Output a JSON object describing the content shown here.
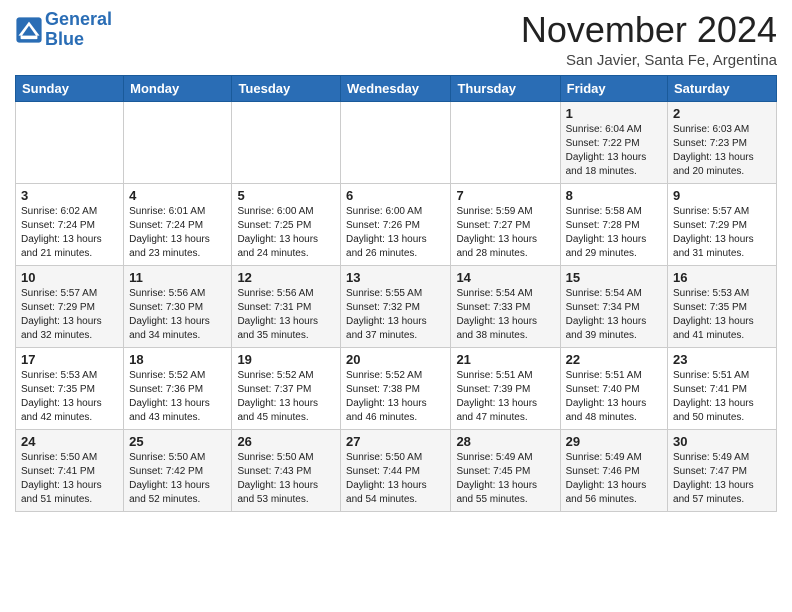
{
  "header": {
    "logo_line1": "General",
    "logo_line2": "Blue",
    "month": "November 2024",
    "location": "San Javier, Santa Fe, Argentina"
  },
  "weekdays": [
    "Sunday",
    "Monday",
    "Tuesday",
    "Wednesday",
    "Thursday",
    "Friday",
    "Saturday"
  ],
  "weeks": [
    [
      {
        "day": "",
        "info": ""
      },
      {
        "day": "",
        "info": ""
      },
      {
        "day": "",
        "info": ""
      },
      {
        "day": "",
        "info": ""
      },
      {
        "day": "",
        "info": ""
      },
      {
        "day": "1",
        "info": "Sunrise: 6:04 AM\nSunset: 7:22 PM\nDaylight: 13 hours\nand 18 minutes."
      },
      {
        "day": "2",
        "info": "Sunrise: 6:03 AM\nSunset: 7:23 PM\nDaylight: 13 hours\nand 20 minutes."
      }
    ],
    [
      {
        "day": "3",
        "info": "Sunrise: 6:02 AM\nSunset: 7:24 PM\nDaylight: 13 hours\nand 21 minutes."
      },
      {
        "day": "4",
        "info": "Sunrise: 6:01 AM\nSunset: 7:24 PM\nDaylight: 13 hours\nand 23 minutes."
      },
      {
        "day": "5",
        "info": "Sunrise: 6:00 AM\nSunset: 7:25 PM\nDaylight: 13 hours\nand 24 minutes."
      },
      {
        "day": "6",
        "info": "Sunrise: 6:00 AM\nSunset: 7:26 PM\nDaylight: 13 hours\nand 26 minutes."
      },
      {
        "day": "7",
        "info": "Sunrise: 5:59 AM\nSunset: 7:27 PM\nDaylight: 13 hours\nand 28 minutes."
      },
      {
        "day": "8",
        "info": "Sunrise: 5:58 AM\nSunset: 7:28 PM\nDaylight: 13 hours\nand 29 minutes."
      },
      {
        "day": "9",
        "info": "Sunrise: 5:57 AM\nSunset: 7:29 PM\nDaylight: 13 hours\nand 31 minutes."
      }
    ],
    [
      {
        "day": "10",
        "info": "Sunrise: 5:57 AM\nSunset: 7:29 PM\nDaylight: 13 hours\nand 32 minutes."
      },
      {
        "day": "11",
        "info": "Sunrise: 5:56 AM\nSunset: 7:30 PM\nDaylight: 13 hours\nand 34 minutes."
      },
      {
        "day": "12",
        "info": "Sunrise: 5:56 AM\nSunset: 7:31 PM\nDaylight: 13 hours\nand 35 minutes."
      },
      {
        "day": "13",
        "info": "Sunrise: 5:55 AM\nSunset: 7:32 PM\nDaylight: 13 hours\nand 37 minutes."
      },
      {
        "day": "14",
        "info": "Sunrise: 5:54 AM\nSunset: 7:33 PM\nDaylight: 13 hours\nand 38 minutes."
      },
      {
        "day": "15",
        "info": "Sunrise: 5:54 AM\nSunset: 7:34 PM\nDaylight: 13 hours\nand 39 minutes."
      },
      {
        "day": "16",
        "info": "Sunrise: 5:53 AM\nSunset: 7:35 PM\nDaylight: 13 hours\nand 41 minutes."
      }
    ],
    [
      {
        "day": "17",
        "info": "Sunrise: 5:53 AM\nSunset: 7:35 PM\nDaylight: 13 hours\nand 42 minutes."
      },
      {
        "day": "18",
        "info": "Sunrise: 5:52 AM\nSunset: 7:36 PM\nDaylight: 13 hours\nand 43 minutes."
      },
      {
        "day": "19",
        "info": "Sunrise: 5:52 AM\nSunset: 7:37 PM\nDaylight: 13 hours\nand 45 minutes."
      },
      {
        "day": "20",
        "info": "Sunrise: 5:52 AM\nSunset: 7:38 PM\nDaylight: 13 hours\nand 46 minutes."
      },
      {
        "day": "21",
        "info": "Sunrise: 5:51 AM\nSunset: 7:39 PM\nDaylight: 13 hours\nand 47 minutes."
      },
      {
        "day": "22",
        "info": "Sunrise: 5:51 AM\nSunset: 7:40 PM\nDaylight: 13 hours\nand 48 minutes."
      },
      {
        "day": "23",
        "info": "Sunrise: 5:51 AM\nSunset: 7:41 PM\nDaylight: 13 hours\nand 50 minutes."
      }
    ],
    [
      {
        "day": "24",
        "info": "Sunrise: 5:50 AM\nSunset: 7:41 PM\nDaylight: 13 hours\nand 51 minutes."
      },
      {
        "day": "25",
        "info": "Sunrise: 5:50 AM\nSunset: 7:42 PM\nDaylight: 13 hours\nand 52 minutes."
      },
      {
        "day": "26",
        "info": "Sunrise: 5:50 AM\nSunset: 7:43 PM\nDaylight: 13 hours\nand 53 minutes."
      },
      {
        "day": "27",
        "info": "Sunrise: 5:50 AM\nSunset: 7:44 PM\nDaylight: 13 hours\nand 54 minutes."
      },
      {
        "day": "28",
        "info": "Sunrise: 5:49 AM\nSunset: 7:45 PM\nDaylight: 13 hours\nand 55 minutes."
      },
      {
        "day": "29",
        "info": "Sunrise: 5:49 AM\nSunset: 7:46 PM\nDaylight: 13 hours\nand 56 minutes."
      },
      {
        "day": "30",
        "info": "Sunrise: 5:49 AM\nSunset: 7:47 PM\nDaylight: 13 hours\nand 57 minutes."
      }
    ]
  ]
}
